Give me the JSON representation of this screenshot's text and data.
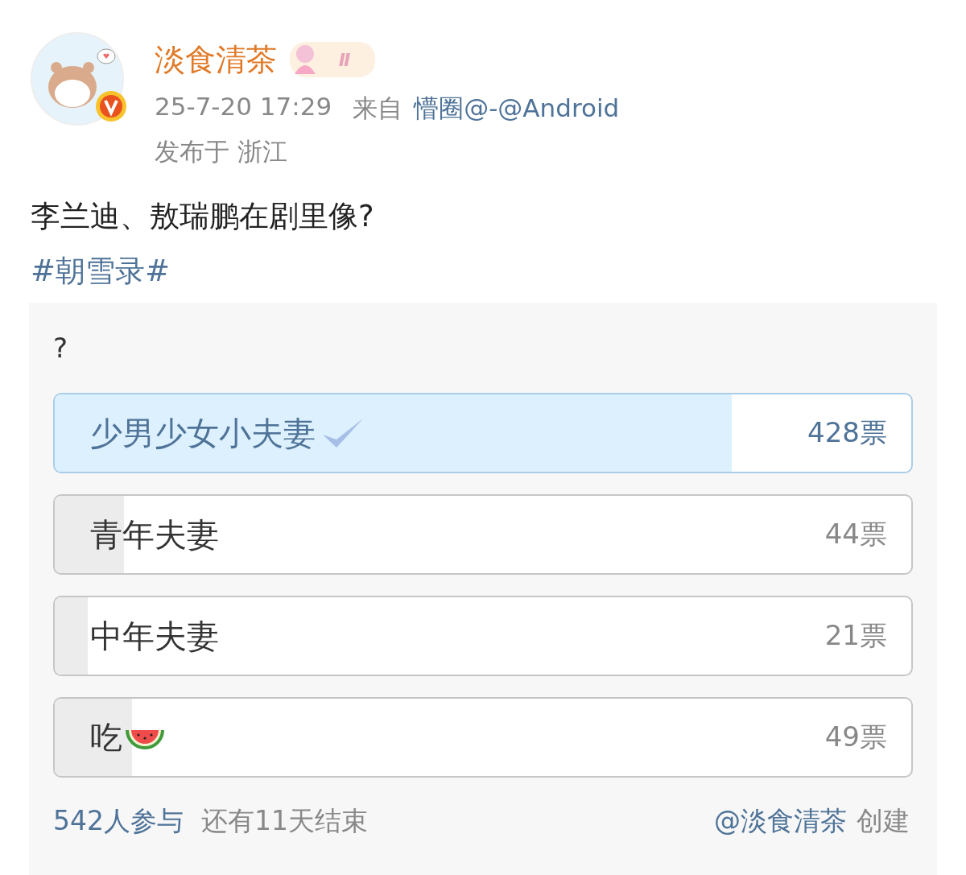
{
  "author": {
    "name": "淡食清茶",
    "badge_text": "Ⅱ",
    "verified": true
  },
  "meta": {
    "time": "25-7-20 17:29",
    "source_prefix": "来自",
    "source": "懵圈@-@Android",
    "location": "发布于 浙江"
  },
  "post": {
    "text": "李兰迪、敖瑞鹏在剧里像?",
    "hashtag": "#朝雪录#"
  },
  "poll": {
    "question": "?",
    "options": [
      {
        "label": "少男少女小夫妻",
        "votes": "428票",
        "level": 0.79,
        "selected": true,
        "has_emoji": false
      },
      {
        "label": "青年夫妻",
        "votes": "44票",
        "level": 0.081,
        "selected": false,
        "has_emoji": false
      },
      {
        "label": "中年夫妻",
        "votes": "21票",
        "level": 0.039,
        "selected": false,
        "has_emoji": false
      },
      {
        "label": "吃",
        "votes": "49票",
        "level": 0.09,
        "selected": false,
        "has_emoji": true
      }
    ],
    "participants": "542人参与",
    "remaining": "还有11天结束",
    "creator": "@淡食清茶",
    "created": "创建"
  }
}
